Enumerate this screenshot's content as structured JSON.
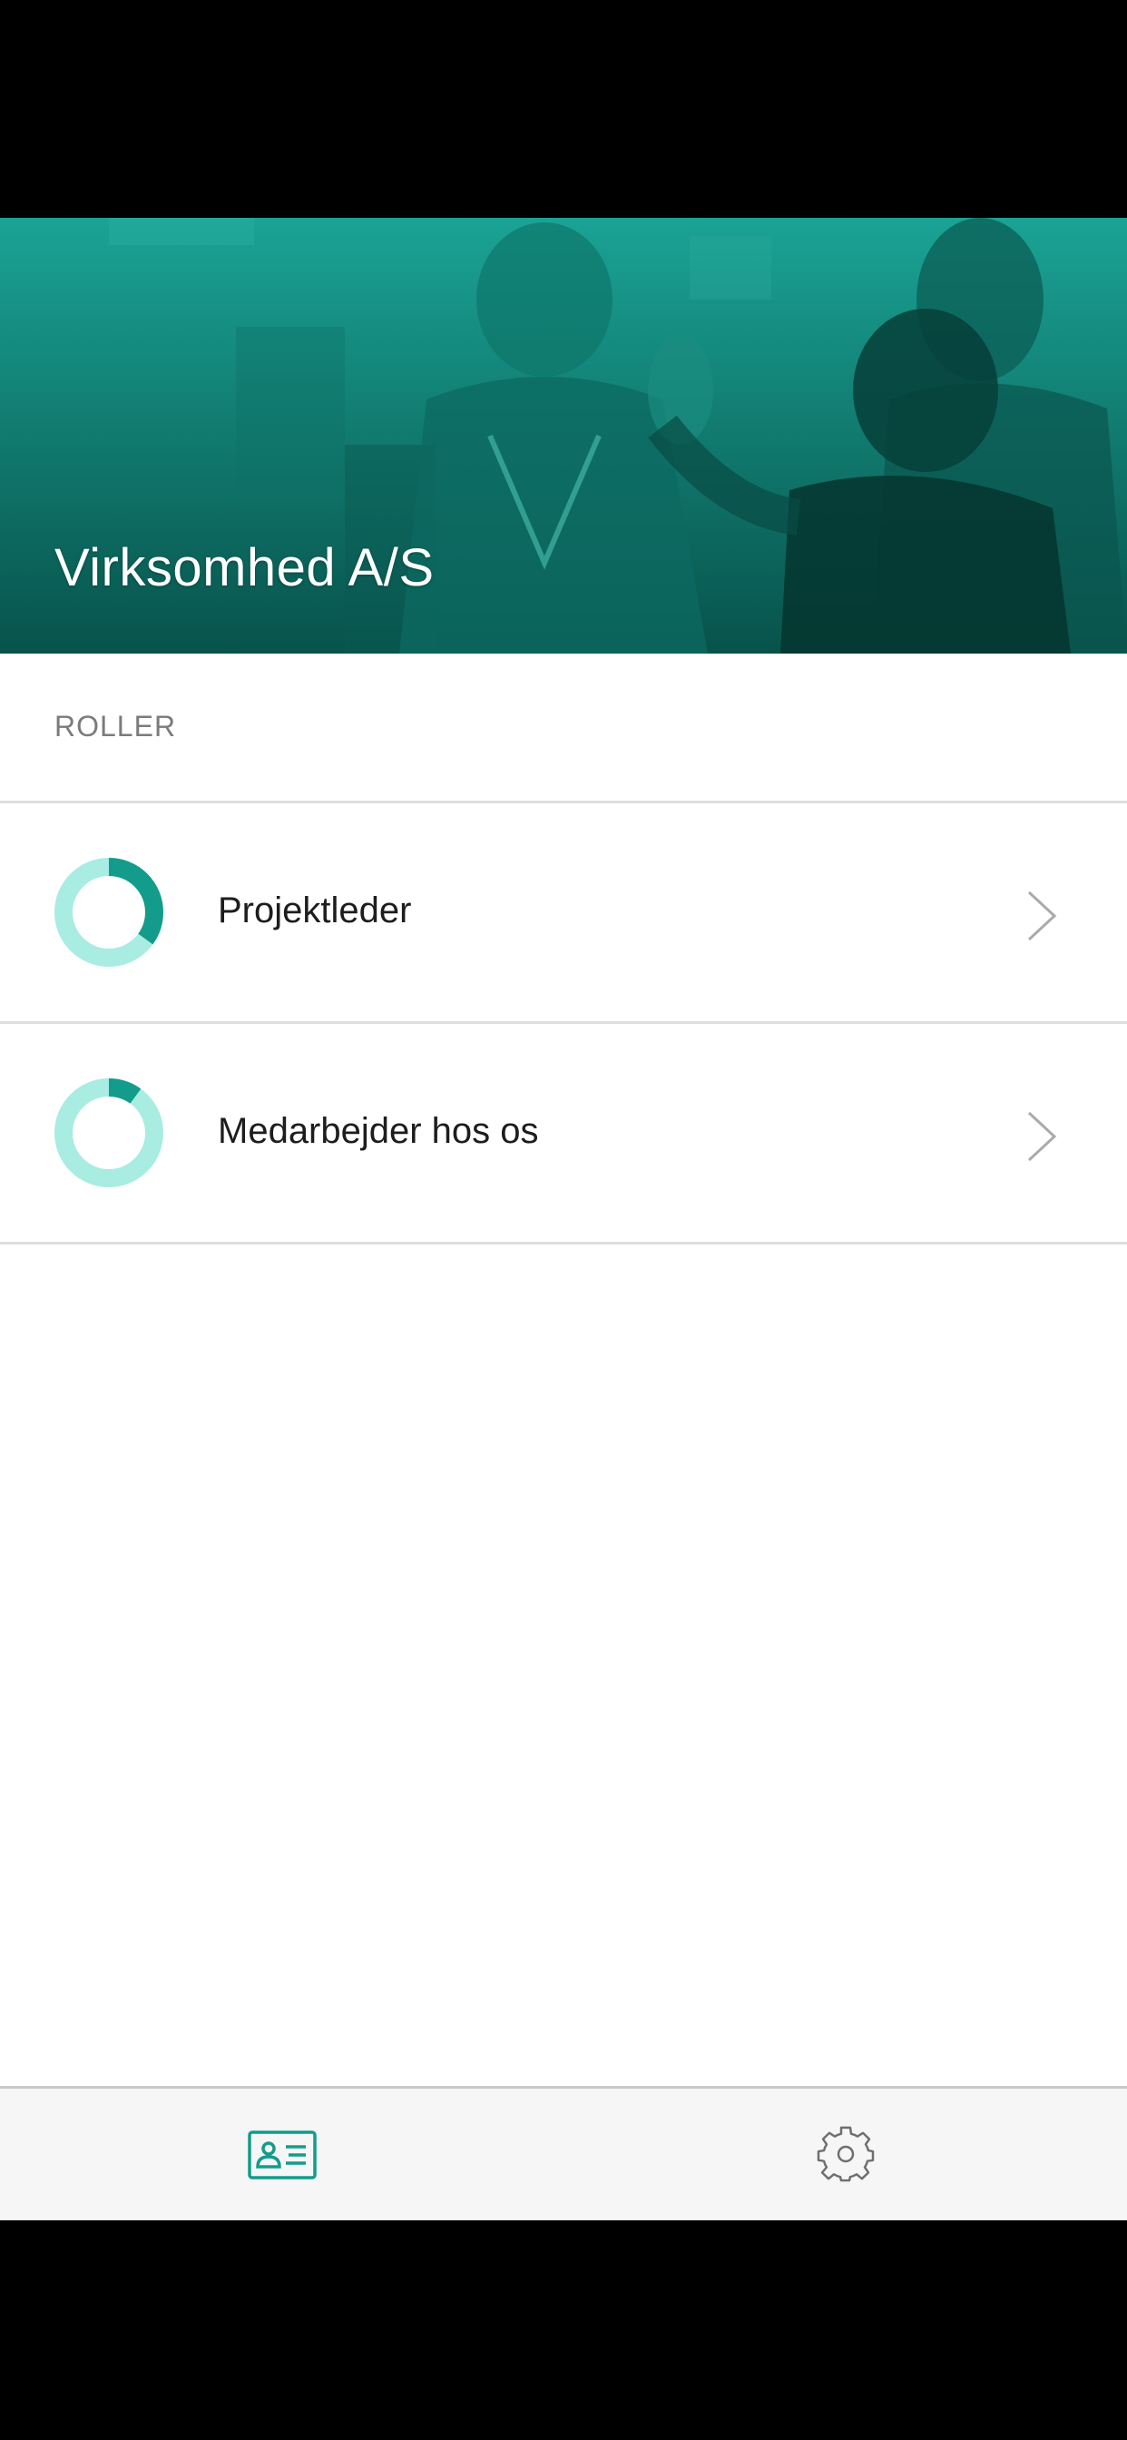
{
  "header": {
    "company_name": "Virksomhed A/S"
  },
  "roles_section": {
    "title": "ROLLER",
    "items": [
      {
        "label": "Projektleder",
        "progress": 0.35
      },
      {
        "label": "Medarbejder hos os",
        "progress": 0.1
      }
    ]
  },
  "colors": {
    "accent": "#139c8c",
    "progress_track": "#a8ece2",
    "hero_top": "#1aa395",
    "hero_bottom": "#07534b",
    "chevron": "#aaaaaa",
    "tab_active": "#139c8c",
    "tab_inactive": "#6f6f6f"
  },
  "tabbar": {
    "tabs": [
      {
        "icon": "id-card-icon",
        "active": true
      },
      {
        "icon": "gear-icon",
        "active": false
      }
    ]
  }
}
